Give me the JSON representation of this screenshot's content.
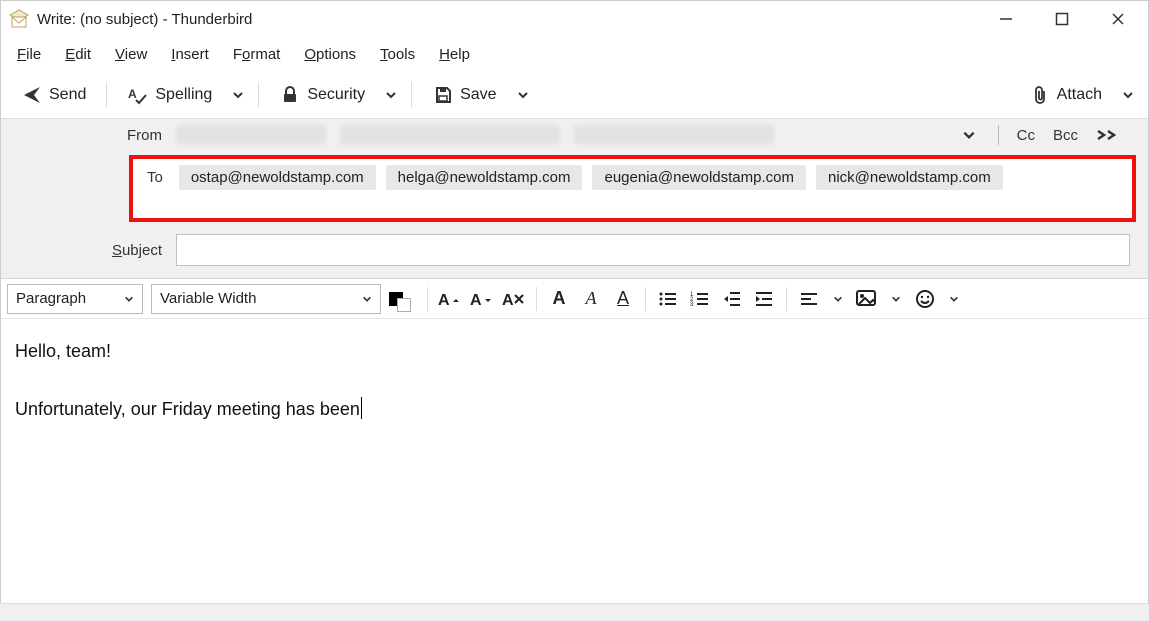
{
  "window": {
    "title": "Write: (no subject) - Thunderbird"
  },
  "menubar": {
    "file": "File",
    "file_u": "F",
    "edit": "Edit",
    "edit_u": "E",
    "view": "View",
    "view_u": "V",
    "insert": "Insert",
    "insert_u": "I",
    "format": "Format",
    "format_u": "o",
    "options": "Options",
    "options_u": "O",
    "tools": "Tools",
    "tools_u": "T",
    "help": "Help",
    "help_u": "H"
  },
  "toolbar": {
    "send": "Send",
    "spelling": "Spelling",
    "security": "Security",
    "save": "Save",
    "attach": "Attach"
  },
  "header": {
    "from_label": "From",
    "to_label": "To",
    "cc_label": "Cc",
    "bcc_label": "Bcc",
    "subject_label_pre": "S",
    "subject_label_rest": "ubject",
    "recipients": [
      "ostap@newoldstamp.com",
      "helga@newoldstamp.com",
      "eugenia@newoldstamp.com",
      "nick@newoldstamp.com"
    ],
    "subject_value": ""
  },
  "formatbar": {
    "para": "Paragraph",
    "font": "Variable Width"
  },
  "body": {
    "line1": "Hello, team!",
    "line2": "Unfortunately, our Friday meeting has been"
  }
}
